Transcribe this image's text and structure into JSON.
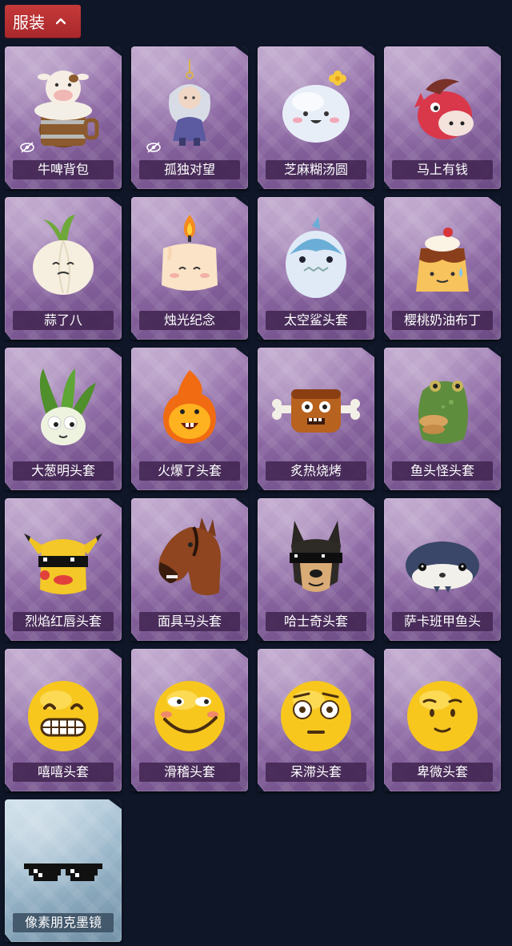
{
  "header": {
    "title": "服装",
    "toggle_icon": "chevron-up-icon"
  },
  "colors": {
    "header_red": "#b9302f",
    "card_purple": "#8f6aa6",
    "card_blue": "#98b5c9",
    "background": "#0f1628"
  },
  "items": [
    {
      "name": "牛啤背包",
      "icon": "cow-beer-barrel-icon",
      "hidden": true
    },
    {
      "name": "孤独对望",
      "icon": "figure-charm-icon",
      "hidden": true
    },
    {
      "name": "芝麻糊汤圆",
      "icon": "rice-ball-icon",
      "hidden": false
    },
    {
      "name": "马上有钱",
      "icon": "red-horse-icon",
      "hidden": false
    },
    {
      "name": "蒜了八",
      "icon": "garlic-icon",
      "hidden": false
    },
    {
      "name": "烛光纪念",
      "icon": "candle-icon",
      "hidden": false
    },
    {
      "name": "太空鲨头套",
      "icon": "shark-egg-icon",
      "hidden": false
    },
    {
      "name": "樱桃奶油布丁",
      "icon": "pudding-icon",
      "hidden": false
    },
    {
      "name": "大葱明头套",
      "icon": "scallion-icon",
      "hidden": false
    },
    {
      "name": "火爆了头套",
      "icon": "fire-face-icon",
      "hidden": false
    },
    {
      "name": "炙热烧烤",
      "icon": "grilled-meat-icon",
      "hidden": false
    },
    {
      "name": "鱼头怪头套",
      "icon": "fish-mask-icon",
      "hidden": false
    },
    {
      "name": "烈焰红唇头套",
      "icon": "yellow-mask-sunglasses-icon",
      "hidden": false
    },
    {
      "name": "面具马头套",
      "icon": "horse-mask-icon",
      "hidden": false
    },
    {
      "name": "哈士奇头套",
      "icon": "husky-mask-icon",
      "hidden": false
    },
    {
      "name": "萨卡班甲鱼头",
      "icon": "sacabambaspis-icon",
      "hidden": false
    },
    {
      "name": "嘻嘻头套",
      "icon": "grin-emoji-icon",
      "hidden": false
    },
    {
      "name": "滑稽头套",
      "icon": "funny-smile-emoji-icon",
      "hidden": false
    },
    {
      "name": "呆滞头套",
      "icon": "dazed-emoji-icon",
      "hidden": false
    },
    {
      "name": "卑微头套",
      "icon": "humble-emoji-icon",
      "hidden": false
    },
    {
      "name": "像素朋克墨镜",
      "icon": "pixel-sunglasses-icon",
      "hidden": false
    }
  ]
}
